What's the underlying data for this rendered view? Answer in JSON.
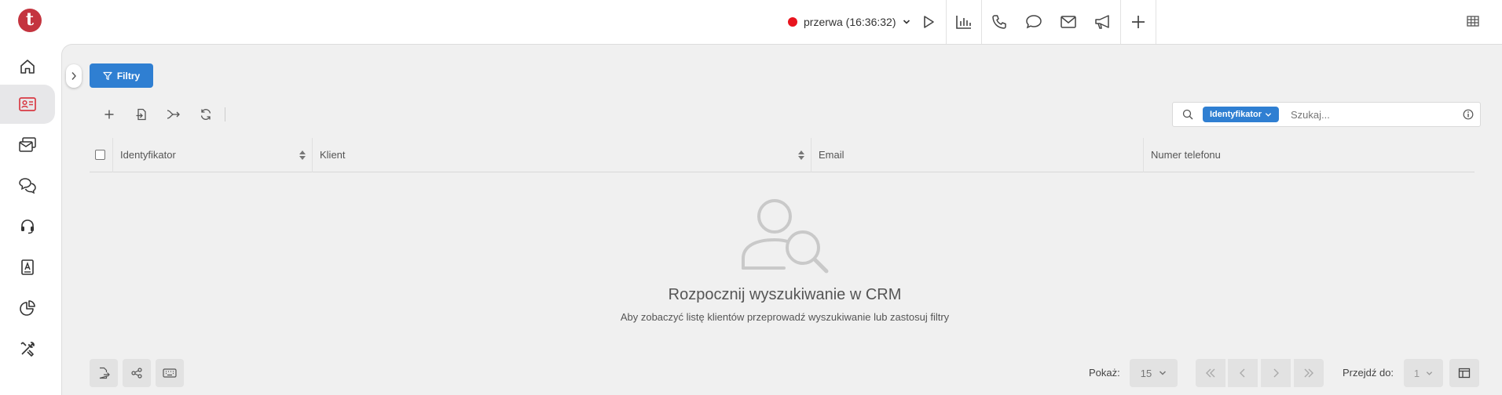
{
  "header": {
    "logo_letter": "t",
    "status_label": "przerwa (16:36:32)",
    "status_color": "#e8141e",
    "icons": [
      "play-icon",
      "chart-icon",
      "phone-icon",
      "chat-bubble-icon",
      "mail-icon",
      "megaphone-icon",
      "plus-icon"
    ],
    "grid_icon": "grid-icon"
  },
  "sidebar": {
    "items": [
      {
        "icon": "home-icon"
      },
      {
        "icon": "contact-card-icon",
        "active": true
      },
      {
        "icon": "mail-stack-icon"
      },
      {
        "icon": "chats-icon"
      },
      {
        "icon": "headset-icon"
      },
      {
        "icon": "address-book-icon"
      },
      {
        "icon": "pie-chart-icon"
      },
      {
        "icon": "tools-icon"
      }
    ]
  },
  "main": {
    "filter_label": "Filtry",
    "toolbar_icons": [
      "add-icon",
      "import-icon",
      "merge-icon",
      "refresh-icon"
    ],
    "search": {
      "field_label": "Identyfikator",
      "placeholder": "Szukaj..."
    },
    "table": {
      "columns": [
        {
          "label": "Identyfikator",
          "sortable": true
        },
        {
          "label": "Klient",
          "sortable": true
        },
        {
          "label": "Email",
          "sortable": false
        },
        {
          "label": "Numer telefonu",
          "sortable": false
        }
      ]
    },
    "empty_state": {
      "title": "Rozpocznij wyszukiwanie w CRM",
      "subtitle": "Aby zobaczyć listę klientów przeprowadź wyszukiwanie lub zastosuj filtry"
    },
    "footer": {
      "show_label": "Pokaż:",
      "page_size": "15",
      "goto_label": "Przejdź do:",
      "goto_value": "1"
    }
  },
  "colors": {
    "accent": "#2f7fd2",
    "brand": "#c4343f"
  }
}
